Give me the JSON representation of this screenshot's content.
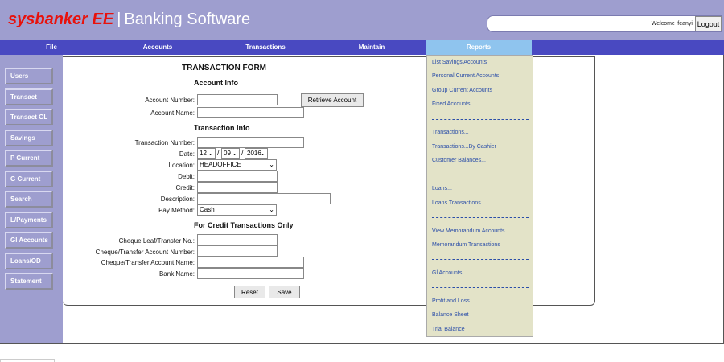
{
  "header": {
    "brand": "sysbanker EE",
    "separator": "|",
    "title": "Banking Software",
    "welcome": "Welcome ifeanyi",
    "logout_label": "Logout"
  },
  "nav": {
    "items": [
      "File",
      "Accounts",
      "Transactions",
      "Maintain",
      "Reports"
    ]
  },
  "sidebar": {
    "items": [
      "Users",
      "Transact",
      "Transact GL",
      "Savings",
      "P Current",
      "G Current",
      "Search",
      "L/Payments",
      "Gl Accounts",
      "Loans/OD",
      "Statement"
    ]
  },
  "form": {
    "title": "TRANSACTION FORM",
    "account_info_title": "Account Info",
    "account_number_label": "Account Number:",
    "account_name_label": "Account Name:",
    "retrieve_label": "Retrieve Account",
    "transaction_info_title": "Transaction Info",
    "transaction_number_label": "Transaction Number:",
    "date_label": "Date:",
    "date_day": "12",
    "date_month": "09",
    "date_year": "2016",
    "date_sep": "/",
    "location_label": "Location:",
    "location_value": "HEADOFFICE",
    "debit_label": "Debit:",
    "credit_label": "Credit:",
    "description_label": "Description:",
    "pay_method_label": "Pay Method:",
    "pay_method_value": "Cash",
    "credit_only_title": "For Credit Transactions Only",
    "cheque_leaf_label": "Cheque Leaf/Transfer No.:",
    "cheque_account_number_label": "Cheque/Transfer Account Number:",
    "cheque_account_name_label": "Cheque/Transfer Account Name:",
    "bank_name_label": "Bank Name:",
    "reset_label": "Reset",
    "save_label": "Save"
  },
  "reports_menu": {
    "items": [
      "List Savings Accounts",
      "Personal Current Accounts",
      "Group Current Accounts",
      "Fixed Accounts",
      "Transactions...",
      "Transactions...By Cashier",
      "Customer Balances...",
      "Loans...",
      "Loans Transactions...",
      "View Memorandum Accounts",
      "Memorandum Transactions",
      "Gl Accounts",
      "Profit and Loss",
      "Balance Sheet",
      "Trial Balance"
    ]
  },
  "icons": {
    "select_chevron": "chevron-down-icon"
  },
  "colors": {
    "header_bg": "#9e9ecf",
    "nav_bg": "#4949c1",
    "nav_active": "#8fc4ee",
    "brand_red": "#e8120c",
    "menu_bg": "#e3e3c8",
    "menu_link": "#2b4ea8"
  }
}
